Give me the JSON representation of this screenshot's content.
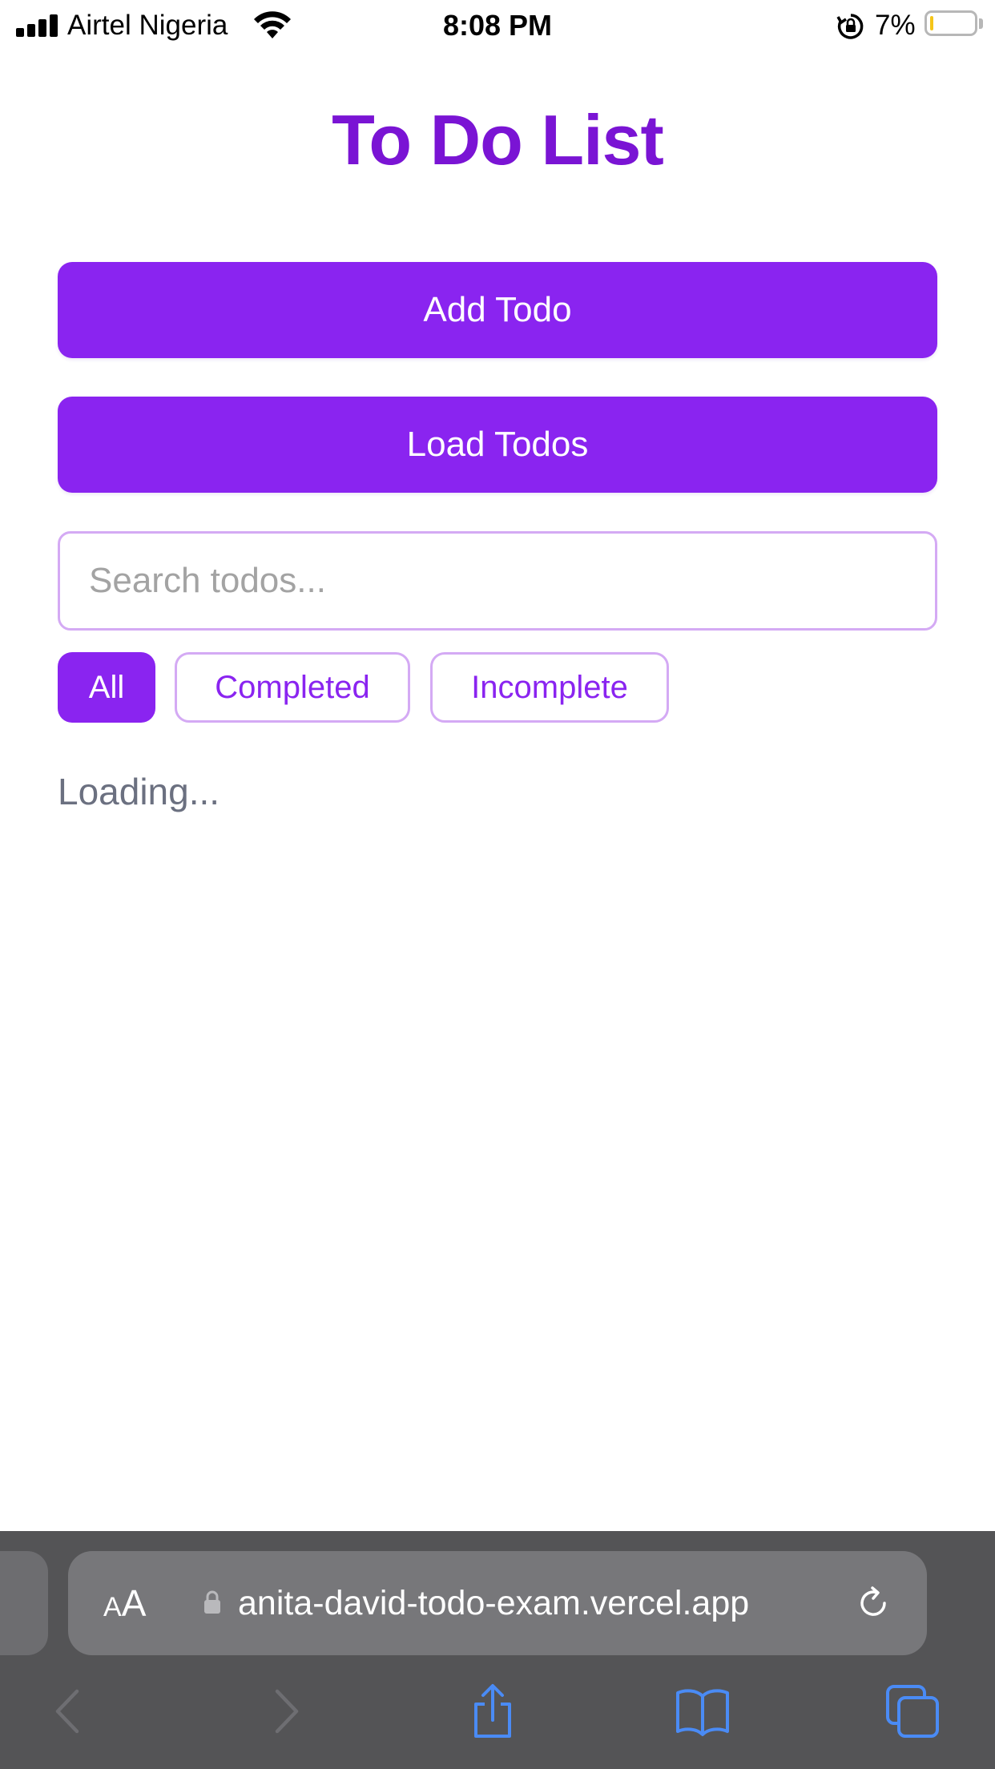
{
  "status_bar": {
    "carrier": "Airtel Nigeria",
    "time": "8:08 PM",
    "battery_percent": "7%",
    "battery_level": 0.07
  },
  "page": {
    "title": "To Do List",
    "add_button_label": "Add Todo",
    "load_button_label": "Load Todos",
    "search_placeholder": "Search todos...",
    "filters": [
      {
        "label": "All",
        "selected": true
      },
      {
        "label": "Completed",
        "selected": false
      },
      {
        "label": "Incomplete",
        "selected": false
      }
    ],
    "loading_text": "Loading..."
  },
  "browser": {
    "text_size_label_small": "A",
    "text_size_label_big": "A",
    "url": "anita-david-todo-exam.vercel.app"
  },
  "colors": {
    "accent": "#8a24f0",
    "title": "#7a14d4",
    "border": "#d4aaf4",
    "loading_text": "#6b7080",
    "safari_bar": "#545456",
    "toolbar_icons": "#4a8bf5"
  },
  "icons": {
    "signal": "cellular-signal-icon",
    "wifi": "wifi-icon",
    "orientation_lock": "orientation-lock-icon",
    "battery": "battery-icon",
    "lock": "lock-icon",
    "reload": "reload-icon",
    "back": "chevron-left-icon",
    "forward": "chevron-right-icon",
    "share": "share-icon",
    "bookmarks": "book-icon",
    "tabs": "tabs-icon"
  }
}
